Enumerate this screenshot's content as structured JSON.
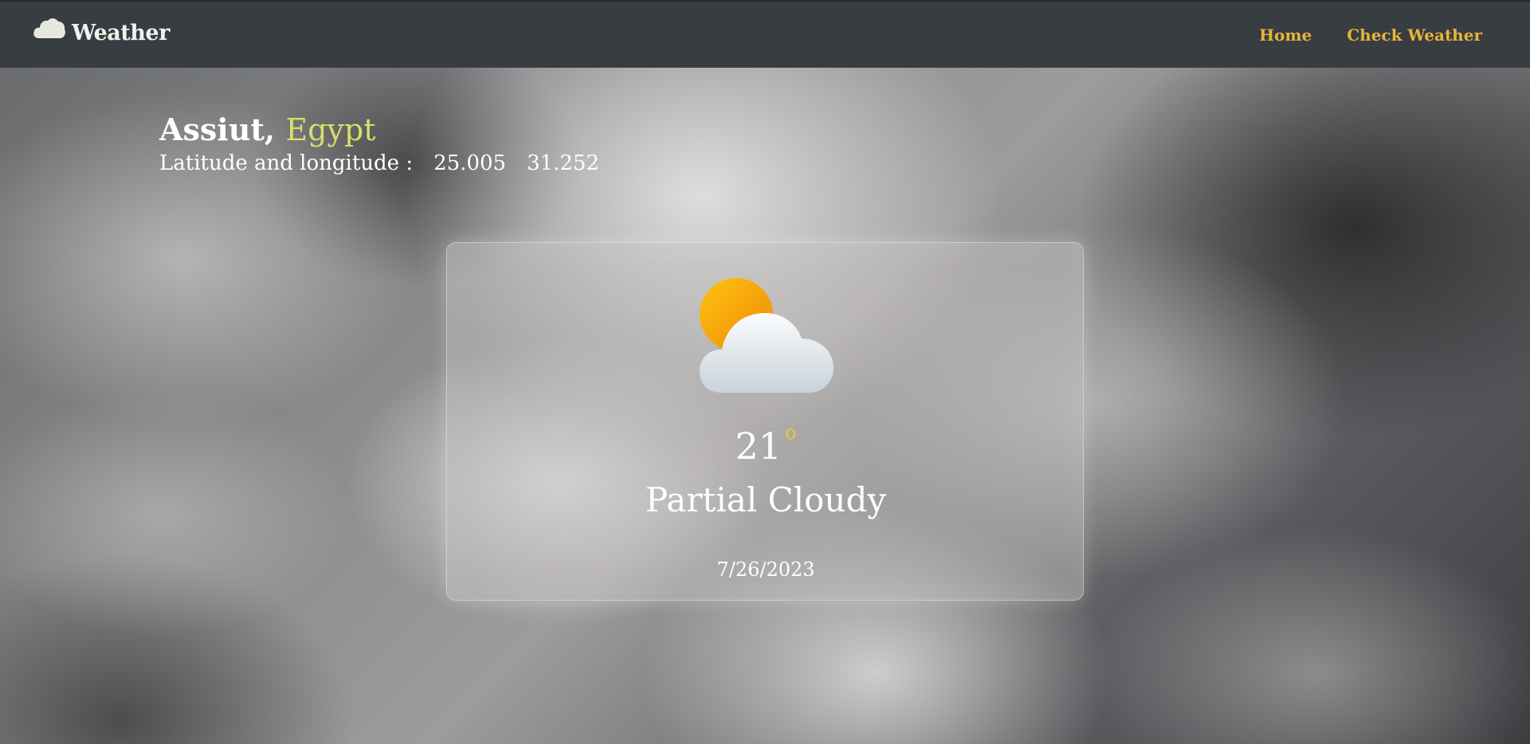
{
  "navbar": {
    "brand_icon": "cloud-icon",
    "brand_label": "Weather",
    "links": [
      {
        "label": "Home"
      },
      {
        "label": "Check Weather"
      }
    ],
    "link_color": "#e7b43b"
  },
  "location": {
    "city": "Assiut,",
    "country": "Egypt",
    "coords_label": "Latitude and longitude :",
    "latitude": "25.005",
    "longitude": "31.252"
  },
  "weather": {
    "icon": "partly-cloudy-icon",
    "temperature": "21",
    "degree_symbol": "o",
    "condition": "Partial Cloudy",
    "date": "7/26/2023"
  },
  "colors": {
    "navbar_bg": "#383d41",
    "accent_yellow": "#f3c632",
    "country_color": "#d7df6a"
  }
}
